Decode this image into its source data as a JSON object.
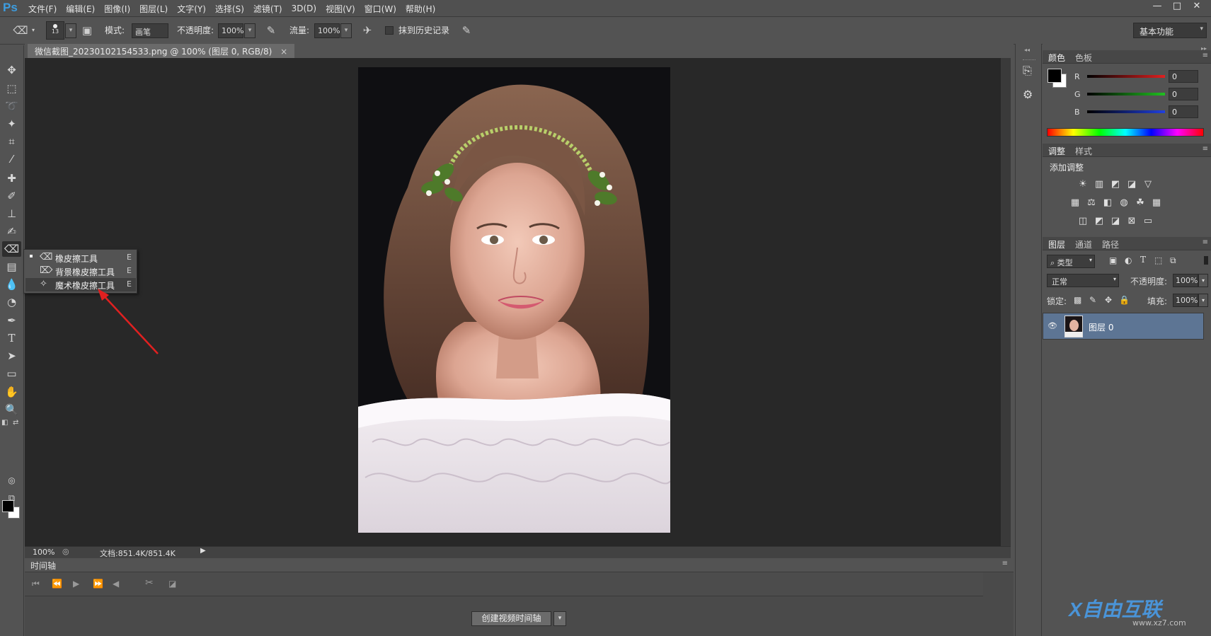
{
  "app": {
    "logo": "Ps"
  },
  "menu": [
    "文件(F)",
    "编辑(E)",
    "图像(I)",
    "图层(L)",
    "文字(Y)",
    "选择(S)",
    "滤镜(T)",
    "3D(D)",
    "视图(V)",
    "窗口(W)",
    "帮助(H)"
  ],
  "window_controls": {
    "minimize": "—",
    "maximize": "□",
    "close": "✕"
  },
  "options_bar": {
    "brush_size": "13",
    "mode_label": "模式:",
    "mode_value": "画笔",
    "opacity_label": "不透明度:",
    "opacity_value": "100%",
    "flow_label": "流量:",
    "flow_value": "100%",
    "erase_history_label": "抹到历史记录",
    "workspace": "基本功能"
  },
  "document": {
    "tab_title": "微信截图_20230102154533.png @ 100% (图层 0, RGB/8)",
    "tab_close": "×"
  },
  "status_bar": {
    "zoom": "100%",
    "doc_info": "文档:851.4K/851.4K"
  },
  "timeline": {
    "title": "时间轴",
    "create_button": "创建视频时间轴"
  },
  "tool_flyout": {
    "items": [
      {
        "label": "橡皮擦工具",
        "shortcut": "E"
      },
      {
        "label": "背景橡皮擦工具",
        "shortcut": "E"
      },
      {
        "label": "魔术橡皮擦工具",
        "shortcut": "E"
      }
    ]
  },
  "color_panel": {
    "tabs": [
      "颜色",
      "色板"
    ],
    "channels": [
      {
        "label": "R",
        "value": "0",
        "color": "#e02020"
      },
      {
        "label": "G",
        "value": "0",
        "color": "#20c020"
      },
      {
        "label": "B",
        "value": "0",
        "color": "#2040e0"
      }
    ]
  },
  "adjustments_panel": {
    "tabs": [
      "调整",
      "样式"
    ],
    "title": "添加调整"
  },
  "layers_panel": {
    "tabs": [
      "图层",
      "通道",
      "路径"
    ],
    "filter_kind": "类型",
    "blend_mode": "正常",
    "opacity_label": "不透明度:",
    "opacity_value": "100%",
    "lock_label": "锁定:",
    "fill_label": "填充:",
    "fill_value": "100%",
    "layers": [
      {
        "name": "图层 0"
      }
    ]
  },
  "watermark": {
    "brand": "X自由互联",
    "url": "www.xz7.com"
  },
  "colors": {
    "accent": "#5d7594",
    "arrow": "#e02020"
  }
}
